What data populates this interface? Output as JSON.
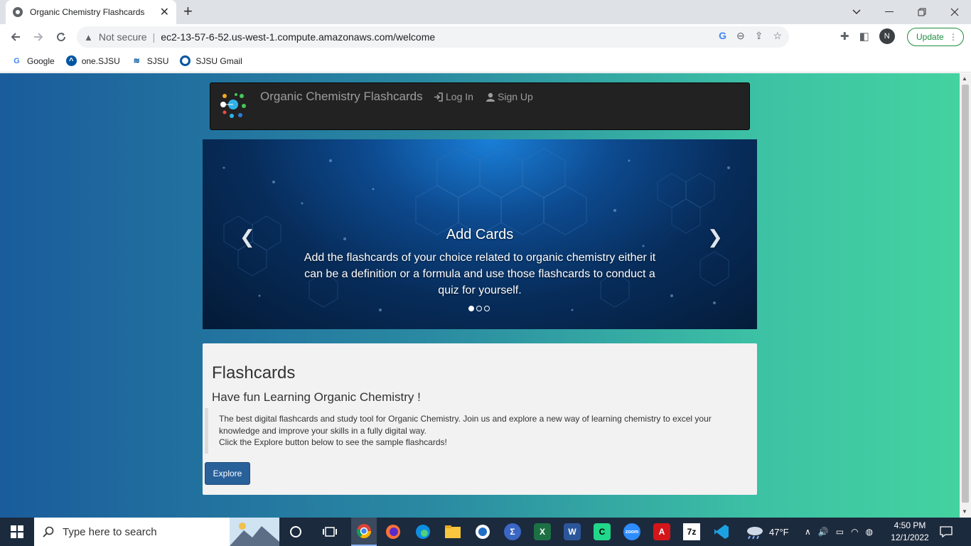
{
  "browser": {
    "tab_title": "Organic Chemistry Flashcards",
    "tab_close": "✕",
    "new_tab": "+",
    "security_label": "Not secure",
    "url": "ec2-13-57-6-52.us-west-1.compute.amazonaws.com/welcome",
    "update_label": "Update",
    "profile_initial": "N",
    "bookmarks": [
      {
        "label": "Google",
        "icon": "google-icon"
      },
      {
        "label": "one.SJSU",
        "icon": "onesjsu-icon"
      },
      {
        "label": "SJSU",
        "icon": "sjsu-icon"
      },
      {
        "label": "SJSU Gmail",
        "icon": "sjsu-gmail-icon"
      }
    ]
  },
  "site": {
    "brand": "Organic Chemistry Flashcards",
    "nav": {
      "login": "Log In",
      "signup": "Sign Up"
    },
    "carousel": {
      "title": "Add Cards",
      "text": "Add the flashcards of your choice related to organic chemistry either it can be a definition or a formula and use those flashcards to conduct a quiz for yourself.",
      "slide_count": 3,
      "active_slide": 0
    },
    "panel": {
      "heading": "Flashcards",
      "subheading": "Have fun Learning Organic Chemistry !",
      "paragraph1": "The best digital flashcards and study tool for Organic Chemistry. Join us and explore a new way of learning chemistry to excel your knowledge and improve your skills in a fully digital way.",
      "paragraph2": "Click the Explore button below to see the sample flashcards!",
      "button": "Explore"
    }
  },
  "taskbar": {
    "search_placeholder": "Type here to search",
    "weather": "47°F",
    "time": "4:50 PM",
    "date": "12/1/2022"
  },
  "colors": {
    "navbar_bg": "#222222",
    "explore_btn": "#28609a",
    "update_green": "#1e8e3e",
    "taskbar_bg": "#1c2a3d"
  }
}
